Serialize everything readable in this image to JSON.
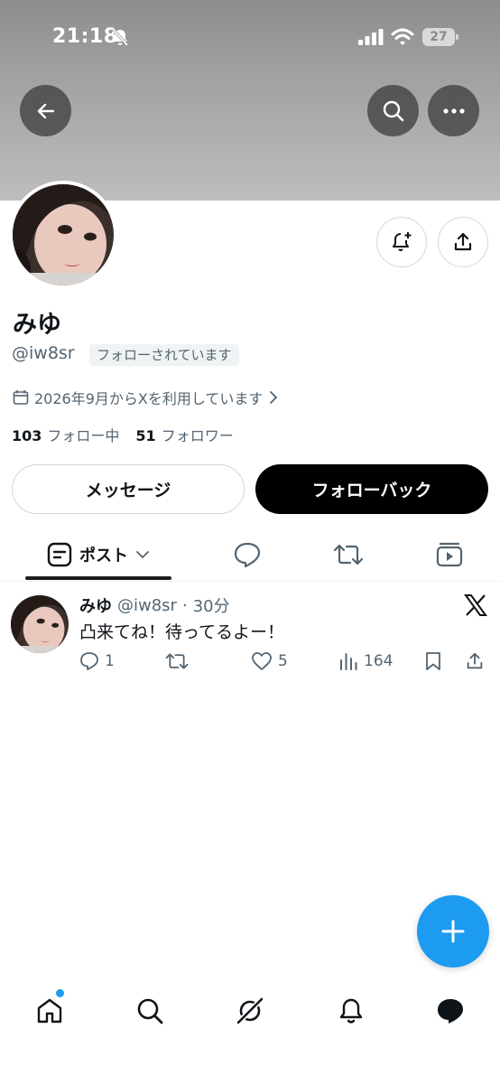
{
  "status_bar": {
    "time": "21:18",
    "battery": "27"
  },
  "header": {
    "back_icon": "back-arrow-icon",
    "search_icon": "search-icon",
    "more_icon": "more-dots-icon"
  },
  "profile": {
    "display_name": "みゆ",
    "handle": "@iw8sr",
    "follows_you": "フォローされています",
    "joined": "2026年9月からXを利用しています",
    "following_count": "103",
    "following_label": "フォロー中",
    "followers_count": "51",
    "followers_label": "フォロワー"
  },
  "actions": {
    "message": "メッセージ",
    "follow_back": "フォローバック"
  },
  "tabs": {
    "posts_label": "ポスト"
  },
  "post": {
    "name": "みゆ",
    "handle": "@iw8sr",
    "separator": "·",
    "time": "30分",
    "text": "凸来てね！待ってるよー！",
    "replies": "1",
    "reposts": "",
    "likes": "5",
    "views": "164"
  },
  "colors": {
    "accent": "#1d9bf0",
    "text": "#0f1419",
    "muted": "#536471",
    "border": "#cfd9de"
  }
}
